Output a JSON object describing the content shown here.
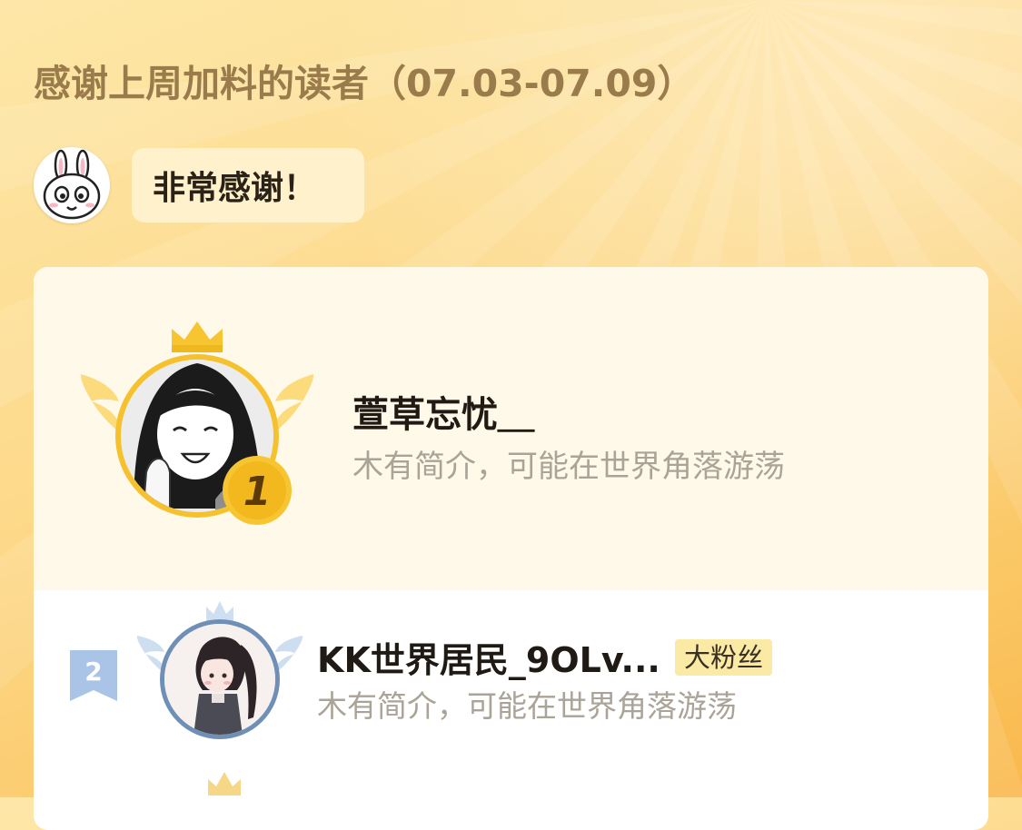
{
  "header": {
    "title": "感谢上周加料的读者（07.03-07.09）"
  },
  "greeting": {
    "text": "非常感谢！"
  },
  "ranking": [
    {
      "rank": "1",
      "name": "萱草忘忧＿",
      "bio": "木有简介，可能在世界角落游荡"
    },
    {
      "rank": "2",
      "name": "KK世界居民_9OLv...",
      "tag": "大粉丝",
      "bio": "木有简介，可能在世界角落游荡"
    }
  ],
  "colors": {
    "title": "#9a7c4c",
    "gold": "#f7c531",
    "silver_blue": "#a9c4e6",
    "tag_bg": "#fbe9a6"
  }
}
